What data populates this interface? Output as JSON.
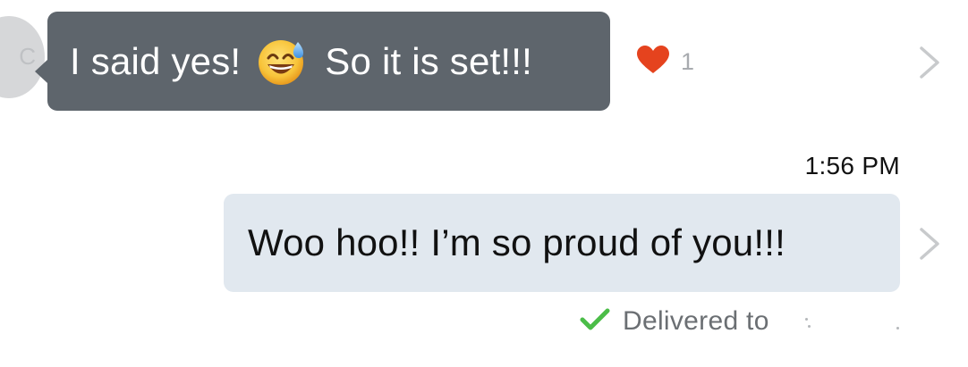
{
  "incoming": {
    "avatar_initial": "C",
    "message_before_emoji": "I said yes!",
    "emoji": "sweat-smile-emoji",
    "message_after_emoji": "So it is set!!!",
    "reaction": {
      "icon": "heart-icon",
      "color": "#e5431e",
      "count": "1"
    }
  },
  "outgoing": {
    "timestamp": "1:56 PM",
    "message": "Woo hoo!! I’m so proud of you!!!",
    "status": {
      "icon": "check-icon",
      "color": "#4bbd48",
      "text": "Delivered to"
    }
  },
  "colors": {
    "incoming_bubble": "#5e656c",
    "outgoing_bubble": "#e1e8ef",
    "chevron": "#c8cacc"
  }
}
